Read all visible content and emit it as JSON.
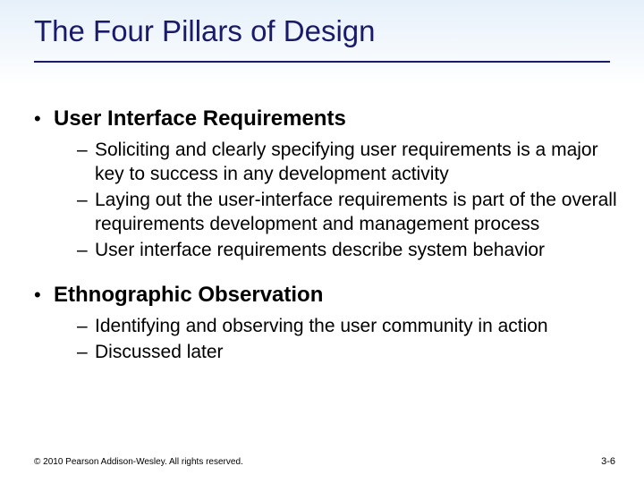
{
  "title": "The Four Pillars of Design",
  "sections": [
    {
      "heading": "User Interface Requirements",
      "items": [
        "Soliciting and clearly specifying user requirements is a major key to success in any development activity",
        "Laying out the user-interface requirements is part of the overall requirements development and management process",
        "User interface requirements describe system behavior"
      ]
    },
    {
      "heading": "Ethnographic Observation",
      "items": [
        "Identifying and observing the user community in action",
        "Discussed later"
      ]
    }
  ],
  "footer": {
    "copyright": "© 2010 Pearson Addison-Wesley. All rights reserved.",
    "page": "3-6"
  }
}
